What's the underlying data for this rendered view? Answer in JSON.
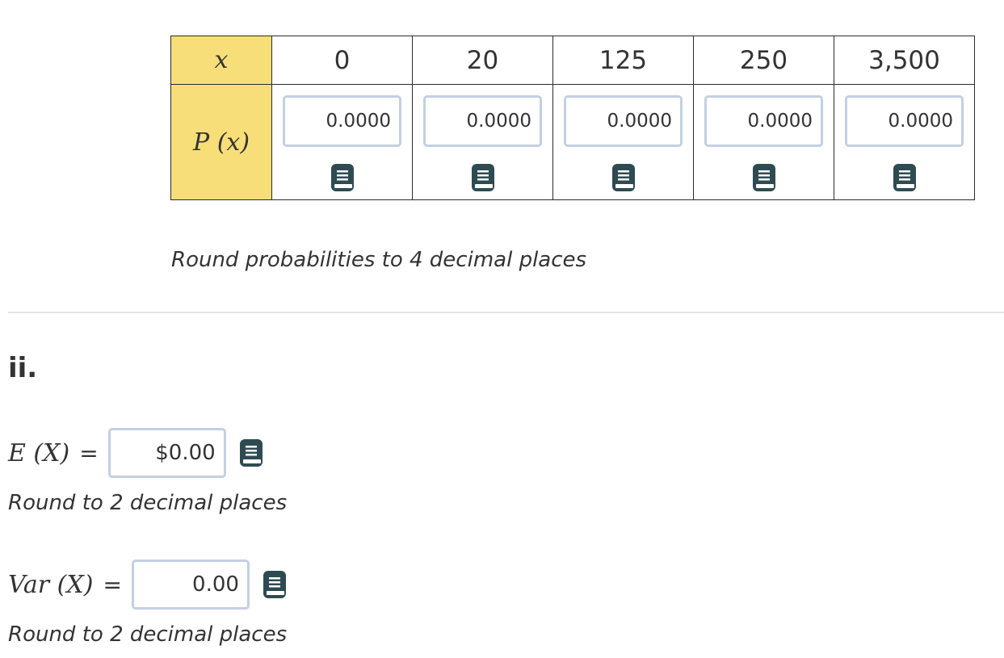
{
  "table": {
    "x_header": "x",
    "p_header": "P (x)",
    "x_values": [
      "0",
      "20",
      "125",
      "250",
      "3,500"
    ],
    "probability_inputs": [
      "0.0000",
      "0.0000",
      "0.0000",
      "0.0000",
      "0.0000"
    ],
    "hint": "Round probabilities to 4 decimal places"
  },
  "part_ii": {
    "label": "ii.",
    "expectation": {
      "label": "E (X)",
      "equals": "=",
      "value": "$0.00",
      "hint": "Round to 2 decimal places"
    },
    "variance": {
      "label": "Var (X)",
      "equals": "=",
      "value": "0.00",
      "hint": "Round to 2 decimal places"
    }
  },
  "icons": {
    "calculator_book": "book-icon"
  },
  "colors": {
    "header_fill": "#f8de78",
    "input_border": "#c3cfe3",
    "icon": "#2f4b52"
  }
}
